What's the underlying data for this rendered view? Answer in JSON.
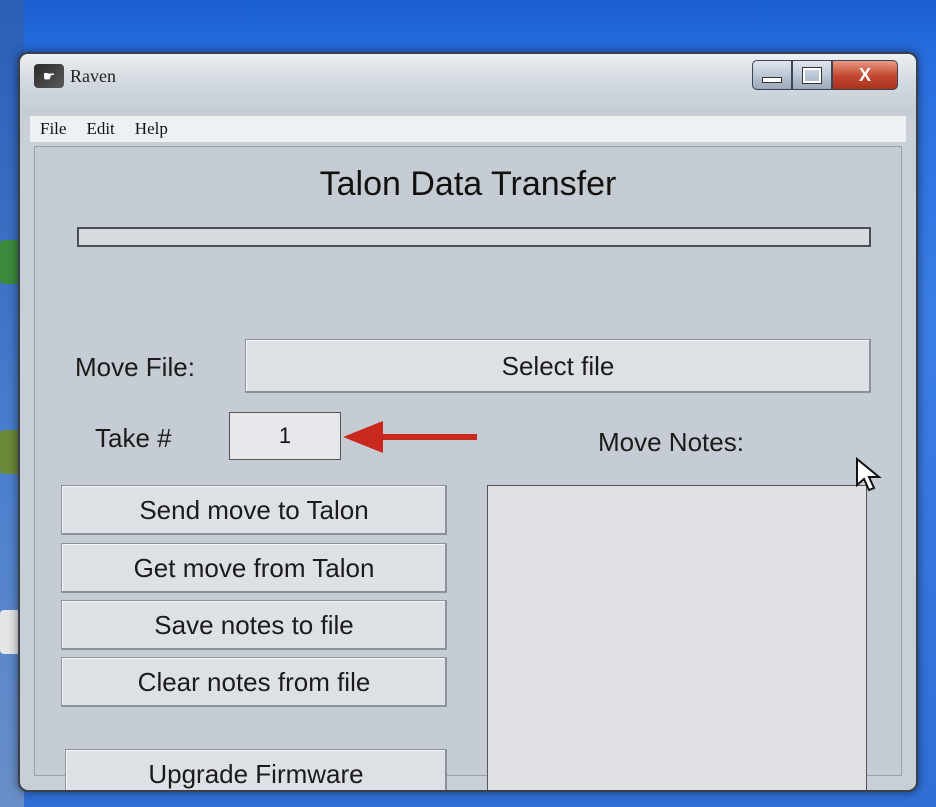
{
  "window": {
    "title": "Raven",
    "close_glyph": "X"
  },
  "menu": [
    "File",
    "Edit",
    "Help"
  ],
  "main": {
    "heading": "Talon Data Transfer",
    "progress": 0,
    "move_file_label": "Move File:",
    "select_file_button": "Select file",
    "take_label": "Take #",
    "take_value": "1",
    "move_notes_label": "Move Notes:",
    "buttons": {
      "send": "Send move to Talon",
      "get": "Get move from Talon",
      "save": "Save notes to file",
      "clear": "Clear notes from file",
      "upgrade": "Upgrade Firmware"
    },
    "notes_value": ""
  },
  "colors": {
    "annotation_arrow": "#c8281e",
    "close_button": "#c2452f"
  }
}
